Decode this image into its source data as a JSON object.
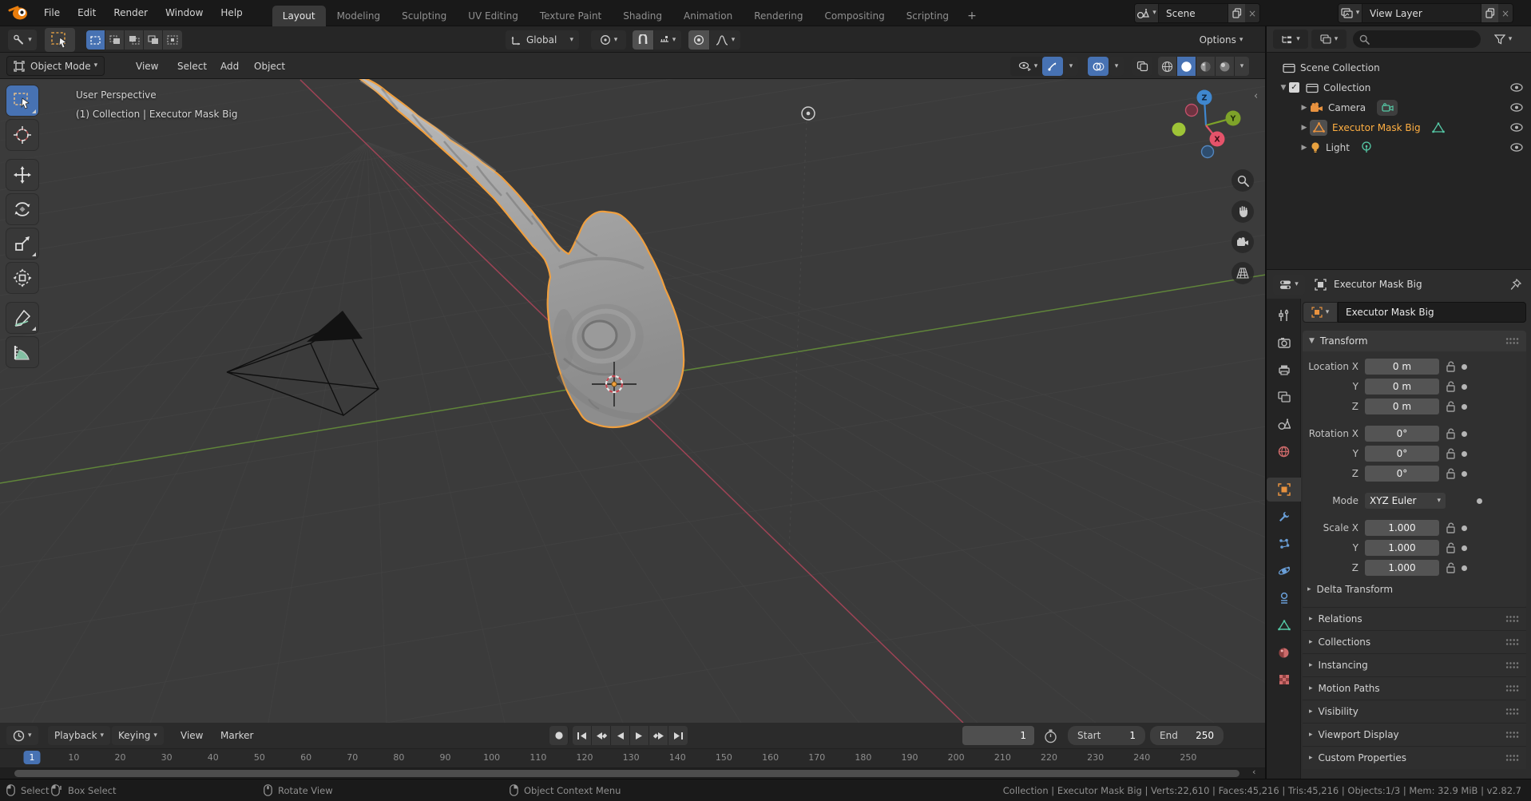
{
  "colors": {
    "accent": "#4772b3",
    "object_orange": "#e8923f",
    "selected_text": "#ffaf42",
    "data_green": "#55c9a6",
    "axis_x": "#b0455a",
    "axis_y": "#6d9e3a",
    "gizmo_z": "#3f87cf"
  },
  "topbar": {
    "menus": [
      "File",
      "Edit",
      "Render",
      "Window",
      "Help"
    ],
    "tabs": [
      "Layout",
      "Modeling",
      "Sculpting",
      "UV Editing",
      "Texture Paint",
      "Shading",
      "Animation",
      "Rendering",
      "Compositing",
      "Scripting"
    ],
    "active_tab": "Layout",
    "add_tab_label": "+",
    "scene": {
      "label": "Scene"
    },
    "view_layer": {
      "label": "View Layer"
    }
  },
  "tool_settings": {
    "orientation": "Global",
    "options_label": "Options"
  },
  "viewport": {
    "mode": "Object Mode",
    "menus": [
      "View",
      "Select",
      "Add",
      "Object"
    ],
    "overlay_line1": "User Perspective",
    "overlay_line2": "(1) Collection | Executor Mask Big",
    "gizmo_axes": {
      "x": "X",
      "y": "Y",
      "z": "Z"
    }
  },
  "outliner": {
    "root": "Scene Collection",
    "items": [
      "Collection",
      "Camera",
      "Executor Mask Big",
      "Light"
    ]
  },
  "properties": {
    "breadcrumb": "Executor Mask Big",
    "name_field": "Executor Mask Big",
    "transform": {
      "title": "Transform",
      "rows": [
        {
          "label": "Location X",
          "value": "0 m"
        },
        {
          "label": "Y",
          "value": "0 m"
        },
        {
          "label": "Z",
          "value": "0 m"
        },
        {
          "label": "Rotation X",
          "value": "0°"
        },
        {
          "label": "Y",
          "value": "0°"
        },
        {
          "label": "Z",
          "value": "0°"
        },
        {
          "label": "Scale X",
          "value": "1.000"
        },
        {
          "label": "Y",
          "value": "1.000"
        },
        {
          "label": "Z",
          "value": "1.000"
        }
      ],
      "mode_label": "Mode",
      "mode_value": "XYZ Euler",
      "delta_label": "Delta Transform"
    },
    "panels": [
      "Relations",
      "Collections",
      "Instancing",
      "Motion Paths",
      "Visibility",
      "Viewport Display",
      "Custom Properties"
    ]
  },
  "timeline": {
    "menus": [
      "Playback",
      "Keying",
      "View",
      "Marker"
    ],
    "current_frame": 1,
    "current_frame_display": "1",
    "start_label": "Start",
    "start_value": "1",
    "end_label": "End",
    "end_value": "250",
    "ticks": [
      1,
      10,
      20,
      30,
      40,
      50,
      60,
      70,
      80,
      90,
      100,
      110,
      120,
      130,
      140,
      150,
      160,
      170,
      180,
      190,
      200,
      210,
      220,
      230,
      240,
      250
    ]
  },
  "status_bar": {
    "hints": [
      "Select",
      "Box Select",
      "Rotate View",
      "Object Context Menu"
    ],
    "stats": "Collection | Executor Mask Big | Verts:22,610 | Faces:45,216 | Tris:45,216 | Objects:1/3 | Mem: 32.9 MiB | v2.82.7"
  }
}
